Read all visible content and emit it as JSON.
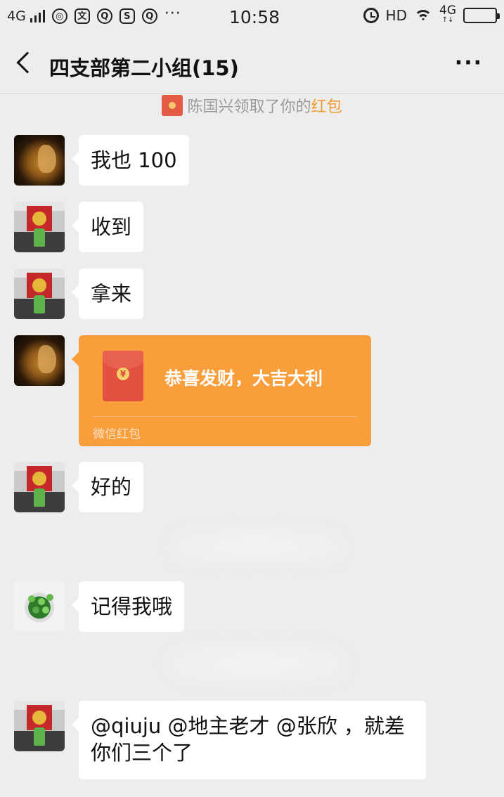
{
  "status_bar": {
    "network": "4G",
    "time": "10:58",
    "hd": "HD",
    "network_right": "4G",
    "left_icons": [
      "globe-icon",
      "translate-icon",
      "qq-icon",
      "sim-s-icon",
      "search-app-icon"
    ],
    "battery_level": 0.4
  },
  "nav": {
    "title": "四支部第二小组(15)",
    "more": "···"
  },
  "notice": {
    "prefix": "陈国兴领取了你的",
    "highlight": "红包"
  },
  "messages": [
    {
      "text": "我也 100",
      "avatar": "lion"
    },
    {
      "text": "收到",
      "avatar": "flag"
    },
    {
      "text": "拿来",
      "avatar": "flag"
    },
    {
      "type": "red_packet",
      "avatar": "lion",
      "greeting": "恭喜发财，大吉大利",
      "footer": "微信红包",
      "coin": "¥"
    },
    {
      "text": "好的",
      "avatar": "flag"
    },
    {
      "text": "记得我哦",
      "avatar": "plant"
    },
    {
      "text": "@qiuju @地主老才 @张欣 ，就差你们三个了",
      "avatar": "flag"
    }
  ],
  "colors": {
    "background": "#ededed",
    "bubble": "#ffffff",
    "red_packet": "#fa9d3b",
    "highlight": "#f29b2f"
  }
}
